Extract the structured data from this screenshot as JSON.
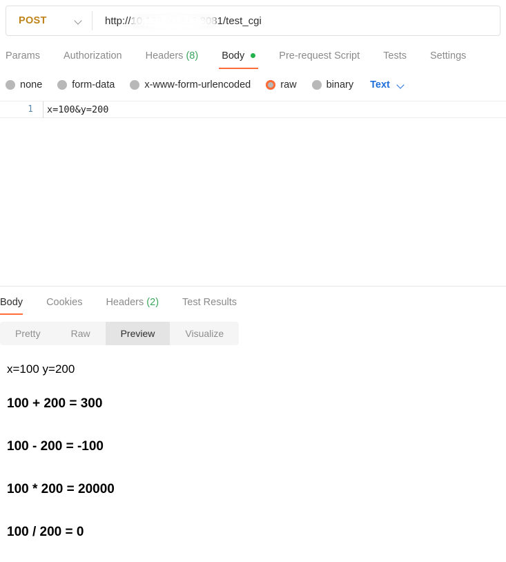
{
  "request": {
    "method": "POST",
    "method_chevron_icon": "chevron-down-icon",
    "url": "http://10.139.60.213:8081/test_cgi",
    "url_visible_prefix": "http://",
    "url_visible_suffix": ":8081/test_cgi",
    "url_redacted_note": "ip-address-blurred",
    "tabs": [
      {
        "label": "Params",
        "active": false,
        "count": "",
        "dot": false
      },
      {
        "label": "Authorization",
        "active": false,
        "count": "",
        "dot": false
      },
      {
        "label": "Headers",
        "active": false,
        "count": "(8)",
        "dot": false
      },
      {
        "label": "Body",
        "active": true,
        "count": "",
        "dot": true
      },
      {
        "label": "Pre-request Script",
        "active": false,
        "count": "",
        "dot": false
      },
      {
        "label": "Tests",
        "active": false,
        "count": "",
        "dot": false
      },
      {
        "label": "Settings",
        "active": false,
        "count": "",
        "dot": false
      }
    ],
    "body_types": [
      {
        "label": "none",
        "selected": false
      },
      {
        "label": "form-data",
        "selected": false
      },
      {
        "label": "x-www-form-urlencoded",
        "selected": false
      },
      {
        "label": "raw",
        "selected": true
      },
      {
        "label": "binary",
        "selected": false
      }
    ],
    "raw_format": "Text",
    "raw_format_chevron_icon": "chevron-down-icon",
    "editor": {
      "line_number": "1",
      "content": "x=100&y=200"
    }
  },
  "response": {
    "tabs": [
      {
        "label": "Body",
        "active": true,
        "count": ""
      },
      {
        "label": "Cookies",
        "active": false,
        "count": ""
      },
      {
        "label": "Headers",
        "active": false,
        "count": "(2)"
      },
      {
        "label": "Test Results",
        "active": false,
        "count": ""
      }
    ],
    "view_modes": [
      {
        "label": "Pretty",
        "active": false
      },
      {
        "label": "Raw",
        "active": false
      },
      {
        "label": "Preview",
        "active": true
      },
      {
        "label": "Visualize",
        "active": false
      }
    ],
    "preview": {
      "plain_line": "x=100 y=200",
      "headings": [
        "100 + 200 = 300",
        "100 - 200 = -100",
        "100 * 200 = 20000",
        "100 / 200 = 0"
      ]
    }
  },
  "colors": {
    "method_post": "#bf8319",
    "accent_orange": "#ff6c37",
    "count_green": "#3ba55c",
    "status_dot_green": "#21b24b",
    "link_blue": "#1e6fd9",
    "radio_gray": "#b8b8b8"
  }
}
